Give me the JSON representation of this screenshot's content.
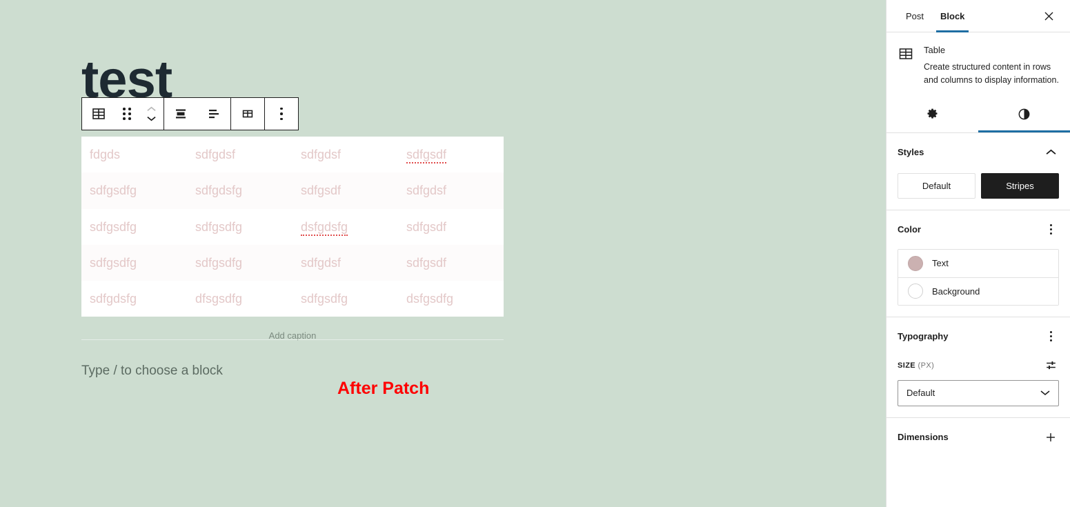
{
  "canvas": {
    "post_title": "test",
    "caption_placeholder": "Add caption",
    "paragraph_placeholder": "Type / to choose a block",
    "annotation": "After Patch",
    "background_color": "#cdddd0",
    "table_text_color": "#e3c8c8"
  },
  "toolbar": {
    "items": [
      {
        "name": "table-block-icon",
        "label": "Table"
      },
      {
        "name": "drag-handle",
        "label": "Drag"
      },
      {
        "name": "move-up-down",
        "label": "Move up or down"
      },
      {
        "name": "vertical-align",
        "label": "Change vertical alignment"
      },
      {
        "name": "column-align",
        "label": "Change column alignment"
      },
      {
        "name": "edit-table",
        "label": "Edit table"
      },
      {
        "name": "more-options",
        "label": "Options"
      }
    ]
  },
  "table": {
    "rows": [
      [
        "fdgds",
        "sdfgdsf",
        "sdfgdsf",
        "sdfgsdf"
      ],
      [
        "sdfgsdfg",
        "sdfgdsfg",
        "sdfgsdf",
        "sdfgdsf"
      ],
      [
        "sdfgsdfg",
        "sdfgsdfg",
        "dsfgdsfg",
        "sdfgsdf"
      ],
      [
        "sdfgsdfg",
        "sdfgsdfg",
        "sdfgdsf",
        "sdfgsdf"
      ],
      [
        "sdfgdsfg",
        "dfsgsdfg",
        "sdfgsdfg",
        "dsfgsdfg"
      ]
    ],
    "misspelled": [
      [
        0,
        3
      ],
      [
        2,
        2
      ]
    ]
  },
  "sidebar": {
    "tabs": [
      {
        "label": "Post",
        "active": false
      },
      {
        "label": "Block",
        "active": true
      }
    ],
    "close_label": "Close settings",
    "block_card": {
      "title": "Table",
      "description": "Create structured content in rows and columns to display information."
    },
    "icon_tabs": [
      {
        "name": "settings-tab",
        "icon": "gear-icon",
        "active": false
      },
      {
        "name": "styles-tab",
        "icon": "contrast-icon",
        "active": true
      }
    ],
    "styles_panel": {
      "title": "Styles",
      "variations": [
        {
          "label": "Default",
          "selected": false
        },
        {
          "label": "Stripes",
          "selected": true
        }
      ]
    },
    "color_panel": {
      "title": "Color",
      "options": [
        {
          "label": "Text",
          "swatch": "#cbb1b1",
          "has_color": true
        },
        {
          "label": "Background",
          "swatch": "#ffffff",
          "has_color": false
        }
      ]
    },
    "typography_panel": {
      "title": "Typography",
      "size_label": "SIZE",
      "size_unit": "(PX)",
      "size_value": "Default"
    },
    "dimensions_panel": {
      "title": "Dimensions"
    },
    "accent_color": "#1e6ea3"
  }
}
